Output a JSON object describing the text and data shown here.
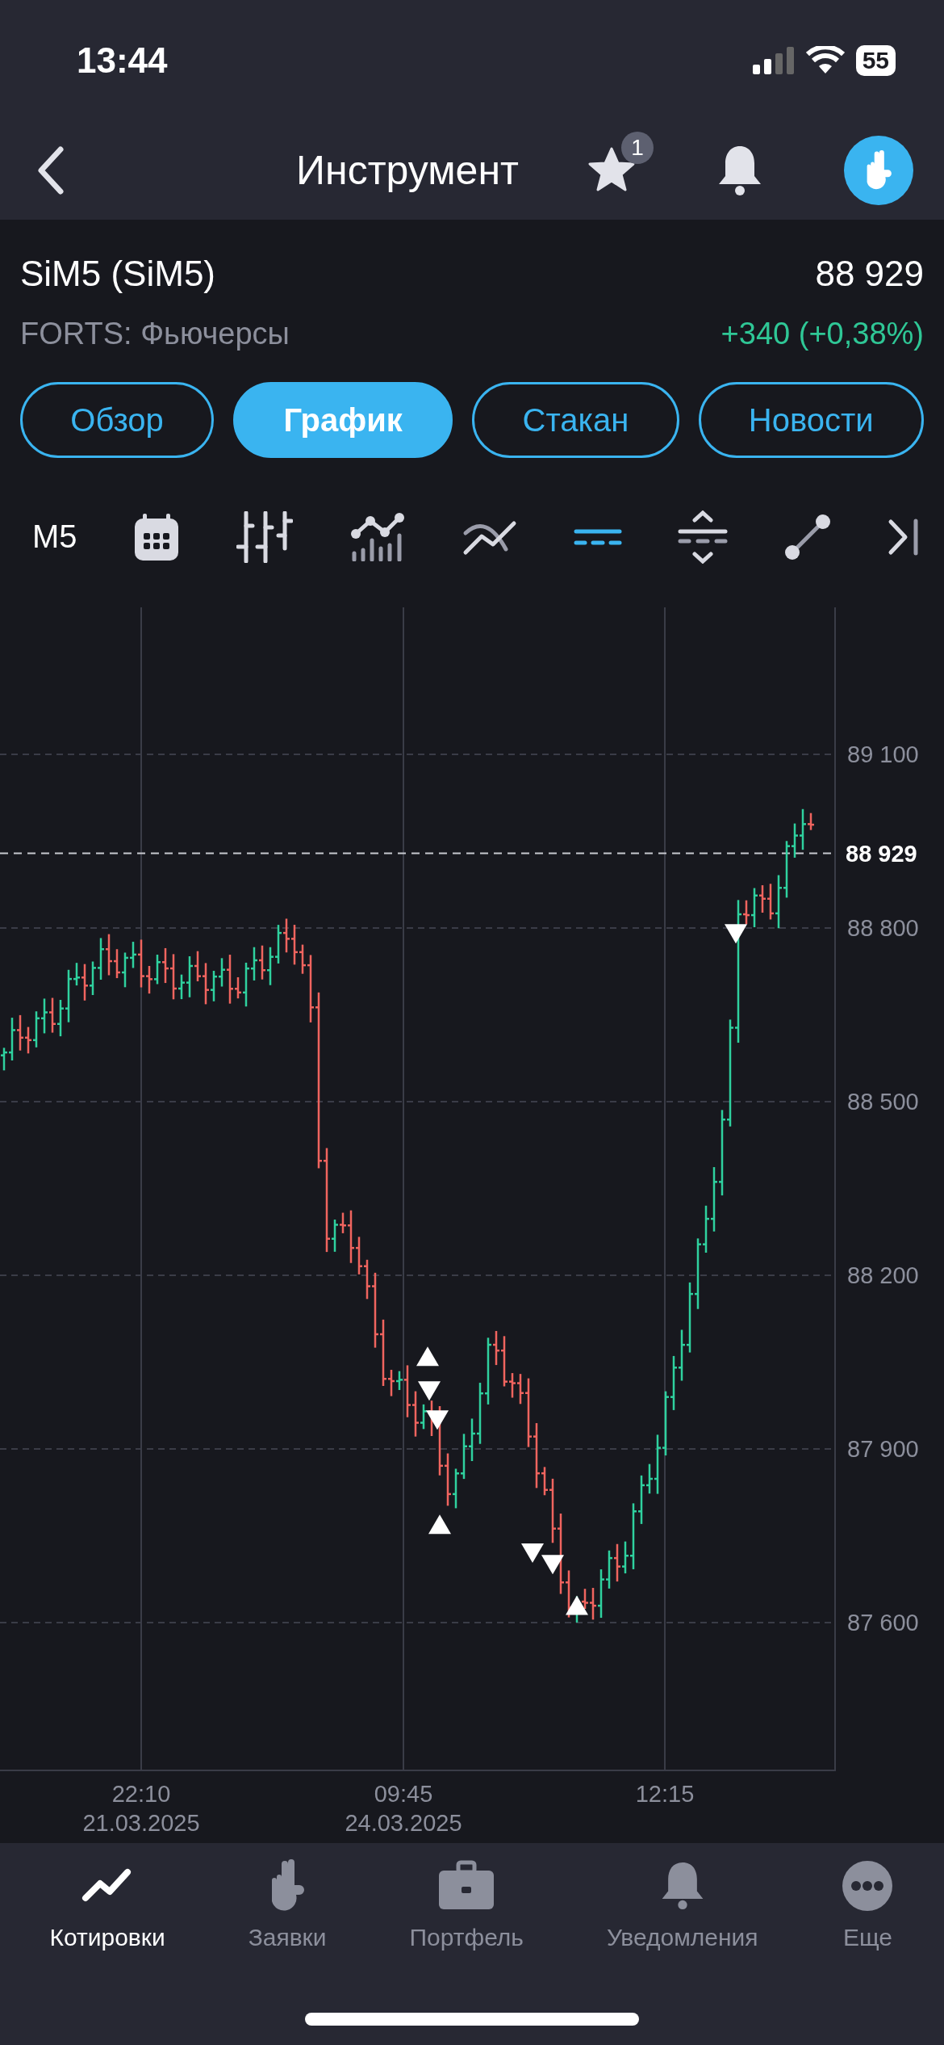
{
  "status_bar": {
    "time": "13:44",
    "battery": "55"
  },
  "nav_bar": {
    "title": "Инструмент",
    "favorites_badge": "1"
  },
  "instrument": {
    "name": "SiM5 (SiM5)",
    "price": "88 929",
    "market": "FORTS: Фьючерсы",
    "change": "+340 (+0,38%)"
  },
  "tabs": [
    {
      "label": "Обзор",
      "selected": false
    },
    {
      "label": "График",
      "selected": true
    },
    {
      "label": "Стакан",
      "selected": false
    },
    {
      "label": "Новости",
      "selected": false
    }
  ],
  "chart_toolbar": {
    "timeframe": "M5",
    "tools": [
      {
        "kind": "calendar",
        "selected": false
      },
      {
        "kind": "bars",
        "selected": false
      },
      {
        "kind": "indicators",
        "selected": false
      },
      {
        "kind": "curve",
        "selected": false
      },
      {
        "kind": "levels",
        "selected": true
      },
      {
        "kind": "range",
        "selected": false
      },
      {
        "kind": "line",
        "selected": false
      },
      {
        "kind": "end",
        "selected": false
      }
    ]
  },
  "chart": {
    "price_labels": [
      "89 100",
      "88 800",
      "88 500",
      "88 200",
      "87 900",
      "87 600"
    ],
    "current_price": "88 929",
    "time_labels": [
      {
        "time": "22:10",
        "date": "21.03.2025"
      },
      {
        "time": "09:45",
        "date": "24.03.2025"
      },
      {
        "time": "12:15"
      }
    ]
  },
  "tab_bar": [
    {
      "label": "Котировки",
      "kind": "quotes",
      "selected": true
    },
    {
      "label": "Заявки",
      "kind": "orders",
      "selected": false
    },
    {
      "label": "Портфель",
      "kind": "portfolio",
      "selected": false
    },
    {
      "label": "Уведомления",
      "kind": "alerts",
      "selected": false
    },
    {
      "label": "Еще",
      "kind": "more",
      "selected": false
    }
  ]
}
